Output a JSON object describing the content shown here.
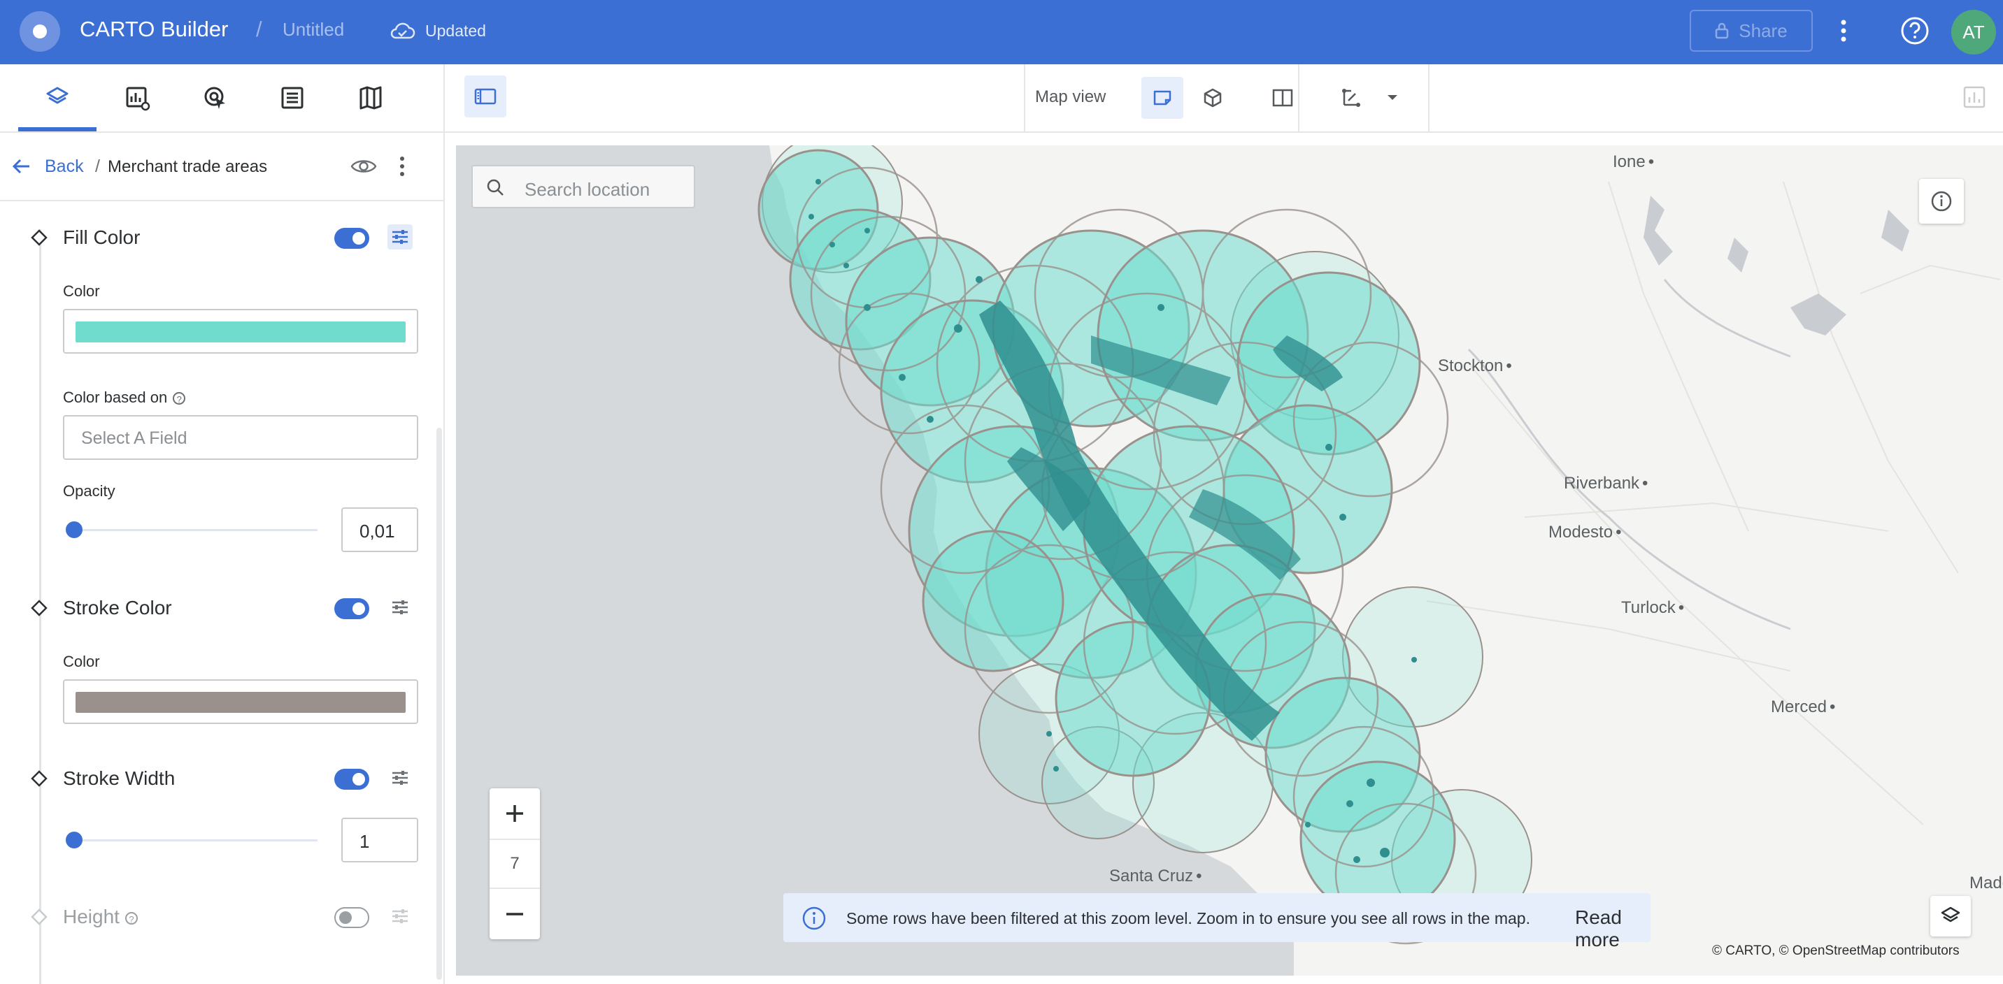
{
  "header": {
    "app_title": "CARTO Builder",
    "separator": "/",
    "doc_title": "Untitled",
    "save_status": "Updated",
    "share_label": "Share",
    "avatar_initials": "AT",
    "bar_color": "#3b6fd4"
  },
  "sidebar": {
    "tabs": [
      "layers",
      "widgets",
      "interactions",
      "sql-parameters",
      "basemaps"
    ],
    "active_tab": "layers",
    "breadcrumb": {
      "back_label": "Back",
      "separator": "/",
      "layer_name": "Merchant trade areas"
    },
    "sections": {
      "fill_color": {
        "title": "Fill Color",
        "enabled": true,
        "color_label": "Color",
        "color": "#6fdccd"
      },
      "color_based_on": {
        "label": "Color based on",
        "placeholder": "Select A Field"
      },
      "opacity": {
        "label": "Opacity",
        "value": "0,01",
        "slider_fraction": 0.01
      },
      "stroke_color": {
        "title": "Stroke Color",
        "enabled": true,
        "color_label": "Color",
        "color": "#9a918c"
      },
      "stroke_width": {
        "title": "Stroke Width",
        "enabled": true,
        "value": "1",
        "slider_fraction": 0.01
      },
      "height": {
        "title": "Height",
        "enabled": false
      }
    }
  },
  "map_toolbar": {
    "map_view_label": "Map view",
    "active_view": "2d"
  },
  "map": {
    "search_placeholder": "Search location",
    "zoom_level": "7",
    "cities": [
      "Ione",
      "Stockton",
      "Riverbank",
      "Modesto",
      "Turlock",
      "Merced",
      "Santa Cruz",
      "Mader"
    ],
    "banner_message": "Some rows have been filtered at this zoom level. Zoom in to ensure you see all rows in the map.",
    "banner_link": "Read more",
    "attribution": "© CARTO, © OpenStreetMap contributors",
    "fill_color": "#6fdccd",
    "stroke_color": "#9a918c",
    "point_color": "#2f8f8f"
  }
}
